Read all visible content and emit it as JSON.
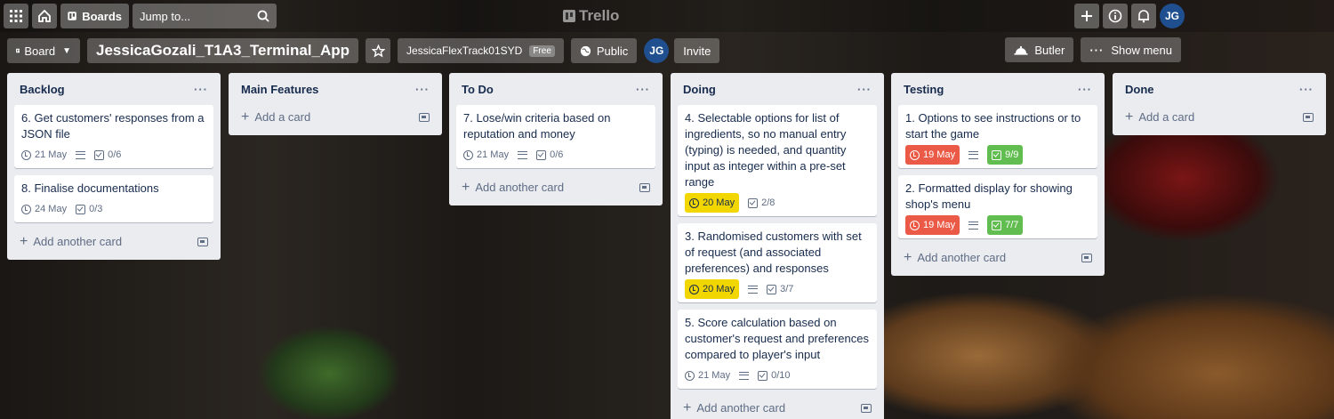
{
  "topbar": {
    "apps_icon": "grid-icon",
    "home_icon": "home-icon",
    "boards_label": "Boards",
    "search_placeholder": "Jump to...",
    "logo_text": "Trello",
    "avatar_initials": "JG"
  },
  "boardbar": {
    "view_label": "Board",
    "board_title": "JessicaGozali_T1A3_Terminal_App",
    "team_label": "JessicaFlexTrack01SYD",
    "team_badge": "Free",
    "visibility_label": "Public",
    "member_initials": "JG",
    "invite_label": "Invite",
    "butler_label": "Butler",
    "menu_label": "Show menu"
  },
  "colors": {
    "due_overdue": "#eb5a46",
    "due_soon": "#f2d600",
    "checklist_complete": "#61bd4f",
    "list_bg": "#ebecf0"
  },
  "lists": [
    {
      "title": "Backlog",
      "cards": [
        {
          "title": "6. Get customers' responses from a JSON file",
          "due": "21 May",
          "checklist": "0/6"
        },
        {
          "title": "8. Finalise documentations",
          "due": "24 May",
          "checklist": "0/3"
        }
      ],
      "add_label": "Add another card"
    },
    {
      "title": "Main Features",
      "cards": [],
      "add_label": "Add a card"
    },
    {
      "title": "To Do",
      "cards": [
        {
          "title": "7. Lose/win criteria based on reputation and money",
          "due": "21 May",
          "checklist": "0/6"
        }
      ],
      "add_label": "Add another card"
    },
    {
      "title": "Doing",
      "cards": [
        {
          "title": "4. Selectable options for list of ingredients, so no manual entry (typing) is needed, and quantity input as integer within a pre-set range",
          "due": "20 May",
          "checklist": "2/8"
        },
        {
          "title": "3. Randomised customers with set of request (and associated preferences) and responses",
          "due": "20 May",
          "checklist": "3/7"
        },
        {
          "title": "5. Score calculation based on customer's request and preferences compared to player's input",
          "due": "21 May",
          "checklist": "0/10"
        }
      ],
      "add_label": "Add another card"
    },
    {
      "title": "Testing",
      "cards": [
        {
          "title": "1. Options to see instructions or to start the game",
          "due": "19 May",
          "checklist": "9/9"
        },
        {
          "title": "2. Formatted display for showing shop's menu",
          "due": "19 May",
          "checklist": "7/7"
        }
      ],
      "add_label": "Add another card"
    },
    {
      "title": "Done",
      "cards": [],
      "add_label": "Add a card"
    }
  ]
}
